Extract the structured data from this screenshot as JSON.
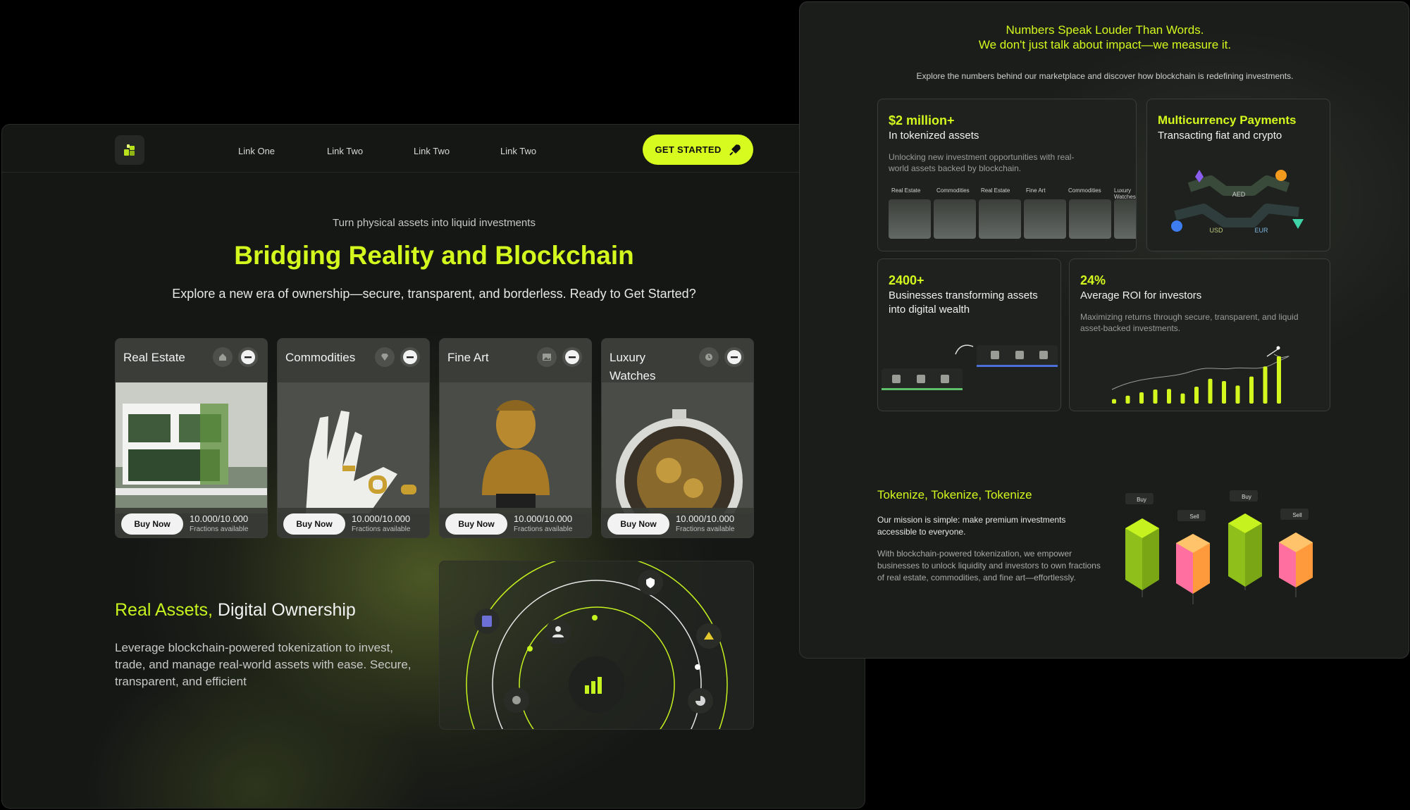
{
  "left": {
    "nav": {
      "links": [
        "Link One",
        "Link Two",
        "Link Two",
        "Link Two"
      ],
      "cta_label": "GET STARTED"
    },
    "hero": {
      "eyebrow": "Turn physical assets into liquid investments",
      "title": "Bridging Reality and Blockchain",
      "subtitle": "Explore a new era of ownership—secure, transparent, and borderless. Ready to Get Started?"
    },
    "cards": [
      {
        "title": "Real Estate",
        "buy_label": "Buy Now",
        "fractions": "10.000/10.000",
        "fractions_label": "Fractions available",
        "icon": "house-icon"
      },
      {
        "title": "Commodities",
        "buy_label": "Buy Now",
        "fractions": "10.000/10.000",
        "fractions_label": "Fractions available",
        "icon": "diamond-icon"
      },
      {
        "title": "Fine Art",
        "buy_label": "Buy Now",
        "fractions": "10.000/10.000",
        "fractions_label": "Fractions available",
        "icon": "image-icon"
      },
      {
        "title": "Luxury Watches",
        "buy_label": "Buy Now",
        "fractions": "10.000/10.000",
        "fractions_label": "Fractions available",
        "icon": "watch-icon"
      }
    ],
    "section": {
      "title_accent": "Real Assets,",
      "title_rest": " Digital Ownership",
      "body": "Leverage blockchain-powered tokenization to invest, trade, and manage real-world assets with ease. Secure, transparent, and efficient"
    }
  },
  "right": {
    "header_line1": "Numbers Speak Louder Than Words.",
    "header_line2": "We don't just talk about impact—we measure it.",
    "subheader": "Explore the numbers behind our marketplace and discover how blockchain is redefining investments.",
    "stats": {
      "tokenized": {
        "value": "$2 million+",
        "label": "In tokenized assets",
        "desc": "Unlocking new investment opportunities with real-world assets backed by blockchain.",
        "categories": [
          "Real Estate",
          "Commodities",
          "Real Estate",
          "Fine Art",
          "Commodities",
          "Luxury Watches"
        ]
      },
      "multicurrency": {
        "title": "Multicurrency Payments",
        "label": "Transacting fiat and crypto",
        "currencies": [
          "AED",
          "USD",
          "EUR"
        ]
      },
      "businesses": {
        "value": "2400+",
        "label": "Businesses transforming assets into digital wealth"
      },
      "roi": {
        "value": "24%",
        "label": "Average ROI for investors",
        "desc": "Maximizing returns through secure, transparent, and liquid asset-backed investments.",
        "bars": [
          0.08,
          0.14,
          0.2,
          0.25,
          0.26,
          0.18,
          0.3,
          0.44,
          0.4,
          0.32,
          0.48,
          0.66,
          0.84
        ]
      }
    },
    "tokenize": {
      "title": "Tokenize, Tokenize, Tokenize",
      "p1": "Our mission is simple: make premium investments accessible to everyone.",
      "p2": "With blockchain-powered tokenization, we empower businesses to unlock liquidity and investors to own fractions of real estate, commodities, and fine art—effortlessly.",
      "tags": [
        "Buy",
        "Sell",
        "Buy",
        "Sell"
      ]
    }
  },
  "colors": {
    "accent": "#d4f71e",
    "cta": "#d7fb1e",
    "bg_dark": "#151715",
    "orange": "#ff9a3c",
    "pink": "#ff6fa0"
  }
}
